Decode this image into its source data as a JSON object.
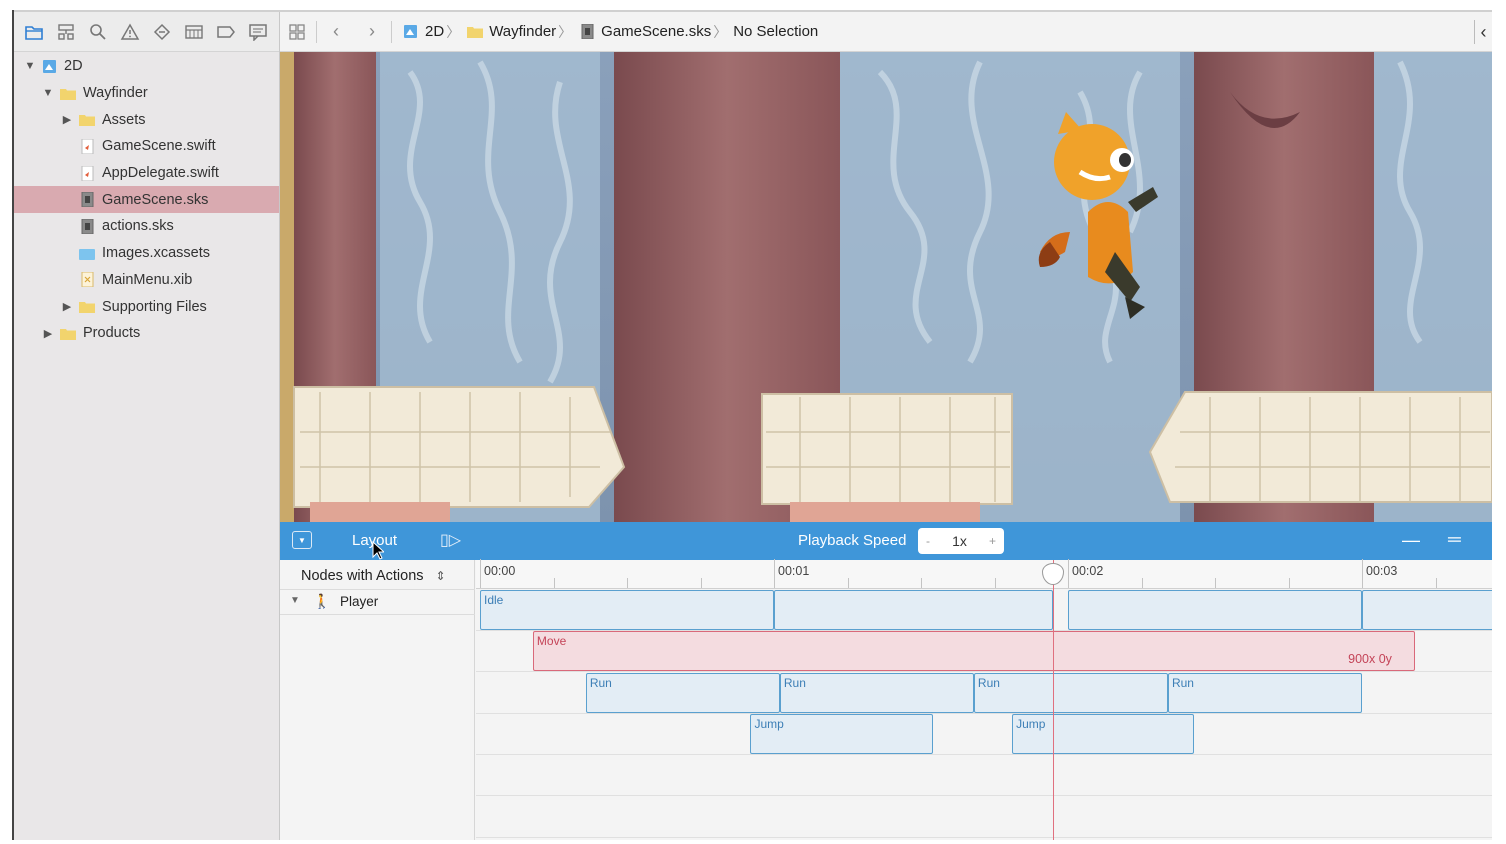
{
  "navigator": {
    "tools": [
      "folder-icon",
      "hierarchy-icon",
      "search-icon",
      "warning-icon",
      "diamond-icon",
      "list-icon",
      "tag-icon",
      "comment-icon"
    ],
    "tree": [
      {
        "label": "2D",
        "icon": "project-icon",
        "disclosure": "▼",
        "indent": 0
      },
      {
        "label": "Wayfinder",
        "icon": "folder-icon",
        "disclosure": "▼",
        "indent": 1
      },
      {
        "label": "Assets",
        "icon": "folder-icon",
        "disclosure": "▶",
        "indent": 2
      },
      {
        "label": "GameScene.swift",
        "icon": "swift-file-icon",
        "disclosure": "",
        "indent": 2
      },
      {
        "label": "AppDelegate.swift",
        "icon": "swift-file-icon",
        "disclosure": "",
        "indent": 2
      },
      {
        "label": "GameScene.sks",
        "icon": "sks-file-icon",
        "disclosure": "",
        "indent": 2,
        "selected": true
      },
      {
        "label": "actions.sks",
        "icon": "sks-file-icon",
        "disclosure": "",
        "indent": 2
      },
      {
        "label": "Images.xcassets",
        "icon": "assets-icon",
        "disclosure": "",
        "indent": 2
      },
      {
        "label": "MainMenu.xib",
        "icon": "xib-file-icon",
        "disclosure": "",
        "indent": 2
      },
      {
        "label": "Supporting Files",
        "icon": "folder-icon",
        "disclosure": "▶",
        "indent": 2
      },
      {
        "label": "Products",
        "icon": "folder-icon",
        "disclosure": "▶",
        "indent": 1
      }
    ]
  },
  "jumpbar": {
    "crumbs": [
      "2D",
      "Wayfinder",
      "GameScene.sks",
      "No Selection"
    ]
  },
  "action_editor": {
    "layout_label": "Layout",
    "playback_speed_label": "Playback Speed",
    "speed_minus": "-",
    "speed_value": "1x",
    "speed_plus": "+",
    "filter_label": "Nodes with Actions",
    "node_label": "Player"
  },
  "timeline": {
    "ruler_labels": [
      "00:00",
      "00:01",
      "00:02",
      "00:03"
    ],
    "playhead_time_seconds": 1.95,
    "actions": [
      {
        "name": "Idle",
        "start": 0.0,
        "end": 1.0,
        "row": 0,
        "type": "normal"
      },
      {
        "name": "",
        "start": 1.0,
        "end": 1.95,
        "row": 0,
        "type": "normal"
      },
      {
        "name": "",
        "start": 2.0,
        "end": 3.0,
        "row": 0,
        "type": "normal"
      },
      {
        "name": "",
        "start": 3.0,
        "end": 3.5,
        "row": 0,
        "type": "normal"
      },
      {
        "name": "Move",
        "start": 0.18,
        "end": 3.18,
        "row": 1,
        "type": "move",
        "value": "900x 0y"
      },
      {
        "name": "Run",
        "start": 0.36,
        "end": 1.02,
        "row": 2,
        "type": "normal"
      },
      {
        "name": "Run",
        "start": 1.02,
        "end": 1.68,
        "row": 2,
        "type": "normal"
      },
      {
        "name": "Run",
        "start": 1.68,
        "end": 2.34,
        "row": 2,
        "type": "normal"
      },
      {
        "name": "Run",
        "start": 2.34,
        "end": 3.0,
        "row": 2,
        "type": "normal"
      },
      {
        "name": "Jump",
        "start": 0.92,
        "end": 1.54,
        "row": 3,
        "type": "normal"
      },
      {
        "name": "Jump",
        "start": 1.81,
        "end": 2.43,
        "row": 3,
        "type": "normal"
      }
    ]
  },
  "colors": {
    "action_bar": "#3f96d9",
    "selection": "#d9aab0",
    "clip_blue": "#5aa0cf",
    "clip_red": "#d9697a"
  }
}
